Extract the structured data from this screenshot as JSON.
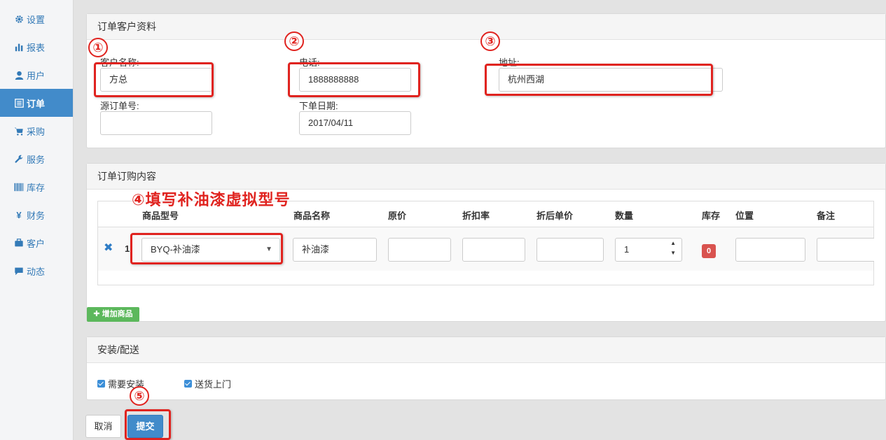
{
  "sidebar": {
    "items": [
      {
        "label": "设置",
        "icon": "gear-icon"
      },
      {
        "label": "报表",
        "icon": "bar-chart-icon"
      },
      {
        "label": "用户",
        "icon": "user-icon"
      },
      {
        "label": "订单",
        "icon": "list-icon",
        "active": true
      },
      {
        "label": "采购",
        "icon": "cart-icon"
      },
      {
        "label": "服务",
        "icon": "wrench-icon"
      },
      {
        "label": "库存",
        "icon": "barcode-icon"
      },
      {
        "label": "财务",
        "icon": "yen-icon"
      },
      {
        "label": "客户",
        "icon": "briefcase-icon"
      },
      {
        "label": "动态",
        "icon": "comment-icon"
      }
    ]
  },
  "customer_panel": {
    "title": "订单客户资料",
    "customer_name_label": "客户名称:",
    "customer_name_value": "方总",
    "phone_label": "电话:",
    "phone_value": "1888888888",
    "address_label": "地址:",
    "address_value": "杭州西湖",
    "source_order_label": "源订单号:",
    "source_order_value": "",
    "order_date_label": "下单日期:",
    "order_date_value": "2017/04/11"
  },
  "items_panel": {
    "title": "订单订购内容",
    "headers": {
      "model": "商品型号",
      "name": "商品名称",
      "original_price": "原价",
      "discount_rate": "折扣率",
      "discounted_price": "折后单价",
      "quantity": "数量",
      "stock": "库存",
      "location": "位置",
      "remark": "备注"
    },
    "row": {
      "index": "1",
      "model": "BYQ-补油漆",
      "name": "补油漆",
      "quantity": "1",
      "stock": "0"
    },
    "add_button": "增加商品"
  },
  "install_panel": {
    "title": "安装/配送",
    "need_install": "需要安装",
    "deliver": "送货上门"
  },
  "actions": {
    "cancel": "取消",
    "submit": "提交"
  },
  "annotations": {
    "n1": "①",
    "n2": "②",
    "n3": "③",
    "n4_text": "④填写补油漆虚拟型号",
    "n5": "⑤"
  },
  "colors": {
    "primary": "#428bca",
    "annotation": "#e0231f",
    "success": "#5cb85c",
    "danger": "#d9534f"
  }
}
